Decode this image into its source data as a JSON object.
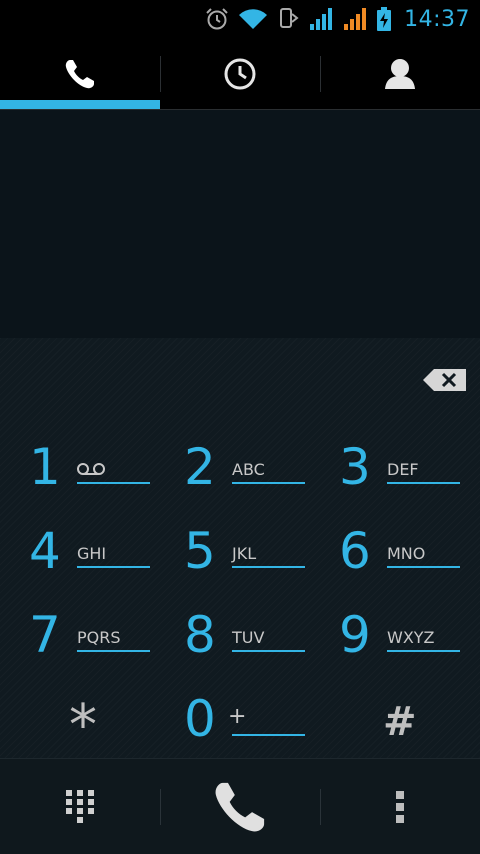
{
  "status_bar": {
    "time": "14:37",
    "icons": [
      "alarm-icon",
      "wifi-icon",
      "sync-icon",
      "signal-blue-icon",
      "signal-orange-icon",
      "battery-charging-icon"
    ],
    "colors": {
      "accent": "#33b5e5",
      "signal_alt": "#f08a24"
    }
  },
  "tabs": [
    {
      "icon": "phone-icon",
      "selected": true
    },
    {
      "icon": "clock-icon",
      "selected": false
    },
    {
      "icon": "contact-icon",
      "selected": false
    }
  ],
  "dialer": {
    "digits_value": "",
    "keys": [
      {
        "num": "1",
        "letters": "",
        "icon": "voicemail-icon"
      },
      {
        "num": "2",
        "letters": "ABC"
      },
      {
        "num": "3",
        "letters": "DEF"
      },
      {
        "num": "4",
        "letters": "GHI"
      },
      {
        "num": "5",
        "letters": "JKL"
      },
      {
        "num": "6",
        "letters": "MNO"
      },
      {
        "num": "7",
        "letters": "PQRS"
      },
      {
        "num": "8",
        "letters": "TUV"
      },
      {
        "num": "9",
        "letters": "WXYZ"
      },
      {
        "num": "*",
        "letters": ""
      },
      {
        "num": "0",
        "letters": "+"
      },
      {
        "num": "#",
        "letters": ""
      }
    ]
  },
  "bottom_bar": {
    "icons": [
      "dialpad-grid-icon",
      "call-icon",
      "overflow-menu-icon"
    ]
  }
}
